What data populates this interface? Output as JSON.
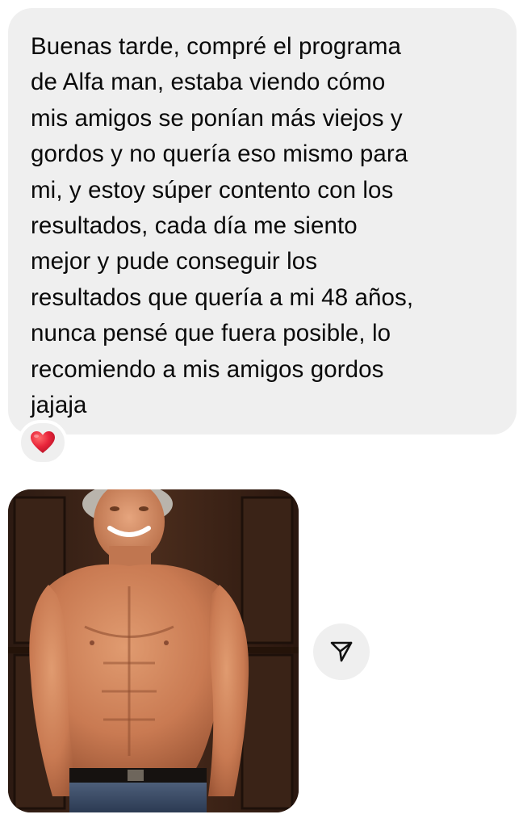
{
  "message": {
    "text": "Buenas tarde, compré el programa\nde Alfa man, estaba viendo cómo\nmis amigos se ponían más viejos y\ngordos y no quería eso mismo para\nmi, y estoy súper contento con los\nresultados, cada día me siento\nmejor y pude conseguir los\nresultados que quería a mi 48 años,\nnunca pensé que fuera posible, lo\nrecomiendo a mis amigos gordos\njajaja"
  },
  "reaction": {
    "icon": "red-heart-icon",
    "color": "#e0243a"
  },
  "attachment": {
    "type": "photo"
  },
  "share_button": {
    "icon": "send-icon"
  },
  "colors": {
    "bubble_bg": "#efefef",
    "text": "#0a0a0a",
    "page_bg": "#ffffff"
  }
}
